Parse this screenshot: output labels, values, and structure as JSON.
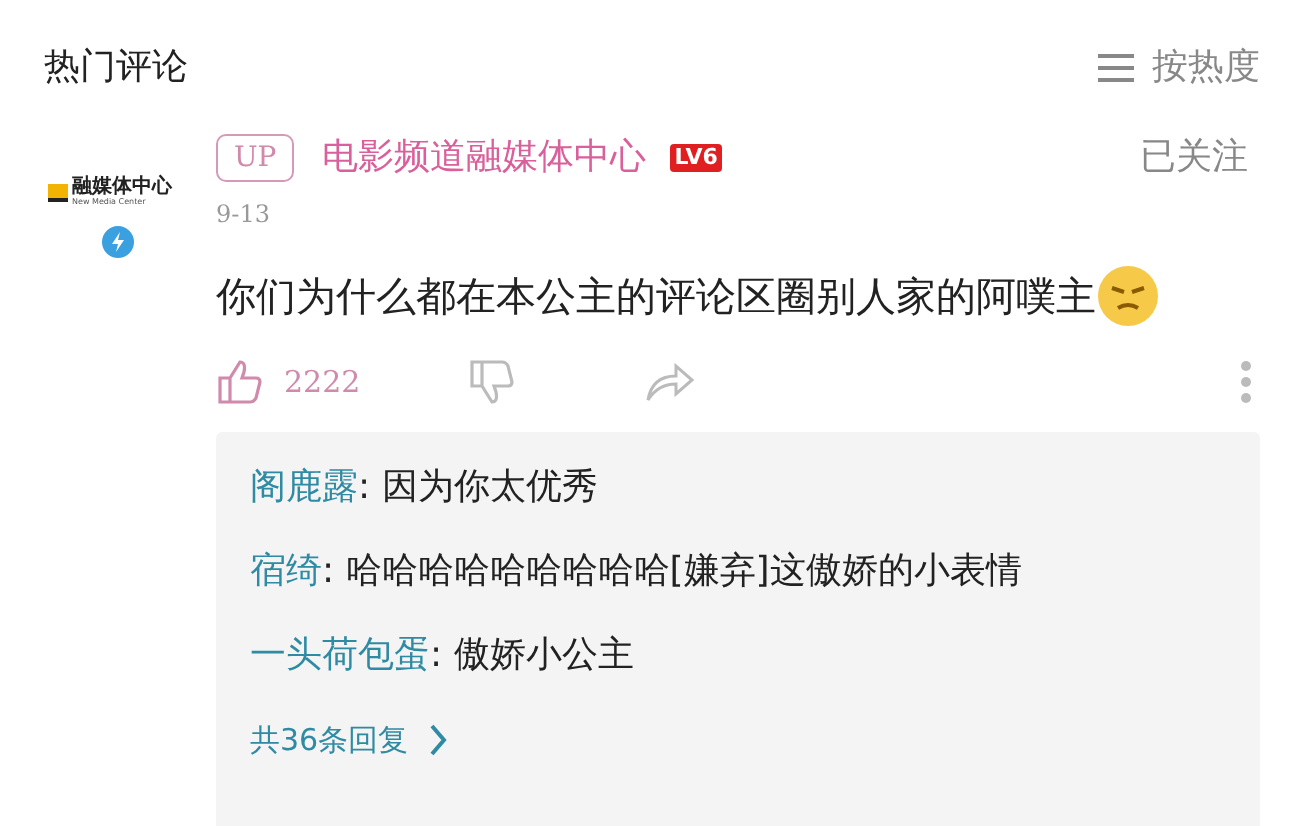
{
  "header": {
    "title": "热门评论",
    "sort": "按热度"
  },
  "comment": {
    "avatar": {
      "logo_text": "融媒体中心",
      "logo_subtext": "New Media Center"
    },
    "up_badge": "UP",
    "author": "电影频道融媒体中心",
    "level": "LV6",
    "follow": "已关注",
    "date": "9-13",
    "text": "你们为什么都在本公主的评论区圈别人家的阿噗主",
    "liked": true,
    "likes": "2222",
    "replies": [
      {
        "name": "阁鹿露",
        "text": ": 因为你太优秀"
      },
      {
        "name": "宿绮",
        "text": ": 哈哈哈哈哈哈哈哈哈[嫌弃]这傲娇的小表情"
      },
      {
        "name": "一头荷包蛋",
        "text": ": 傲娇小公主"
      }
    ],
    "more_replies": "共36条回复"
  }
}
